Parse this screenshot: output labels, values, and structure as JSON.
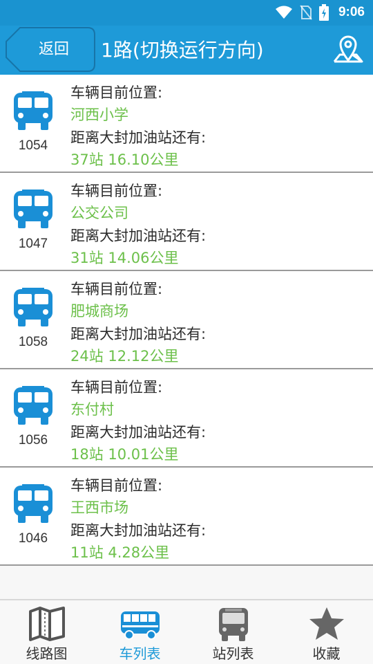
{
  "status_bar": {
    "time": "9:06"
  },
  "header": {
    "back_label": "返回",
    "title": "1路(切换运行方向)"
  },
  "labels": {
    "position_label": "车辆目前位置:",
    "distance_label": "距离大封加油站还有:"
  },
  "buses": [
    {
      "number": "1054",
      "location": "河西小学",
      "distance": "37站  16.10公里"
    },
    {
      "number": "1047",
      "location": "公交公司",
      "distance": "31站  14.06公里"
    },
    {
      "number": "1058",
      "location": "肥城商场",
      "distance": "24站  12.12公里"
    },
    {
      "number": "1056",
      "location": "东付村",
      "distance": "18站  10.01公里"
    },
    {
      "number": "1046",
      "location": "王西市场",
      "distance": "11站  4.28公里"
    }
  ],
  "tabs": [
    {
      "label": "线路图",
      "icon": "map-icon"
    },
    {
      "label": "车列表",
      "icon": "bus-side-icon",
      "active": true
    },
    {
      "label": "站列表",
      "icon": "bus-front-icon"
    },
    {
      "label": "收藏",
      "icon": "star-icon"
    }
  ],
  "colors": {
    "header_blue": "#1e9ad8",
    "status_blue": "#1a93d0",
    "value_green": "#6cc04a",
    "icon_blue": "#1a8fd6",
    "icon_gray": "#666666"
  }
}
